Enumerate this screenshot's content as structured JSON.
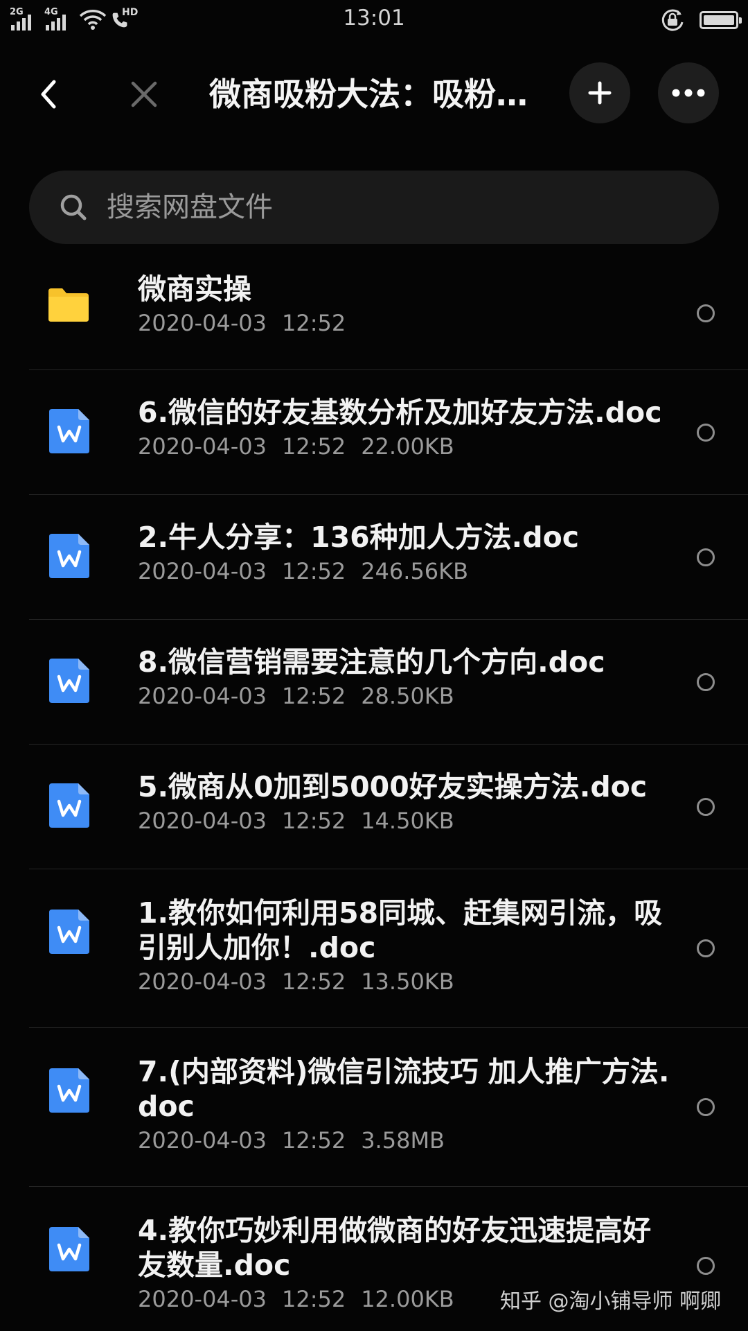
{
  "status_bar": {
    "time": "13:01",
    "signal_1_label": "2G",
    "signal_2_label": "4G",
    "call_label": "HD",
    "icons": [
      "signal-icon",
      "wifi-icon",
      "call-icon",
      "rotation-lock-icon",
      "battery-icon"
    ]
  },
  "header": {
    "title": "微商吸粉大法：吸粉…",
    "back_icon": "back-arrow-icon",
    "close_icon": "close-icon",
    "add_icon": "plus-icon",
    "more_icon": "more-icon"
  },
  "search": {
    "placeholder": "搜索网盘文件",
    "value": ""
  },
  "files": [
    {
      "type": "folder",
      "name": "微商实操",
      "date": "2020-04-03",
      "time": "12:52",
      "size": ""
    },
    {
      "type": "doc",
      "name": "6.微信的好友基数分析及加好友方法.doc",
      "date": "2020-04-03",
      "time": "12:52",
      "size": "22.00KB"
    },
    {
      "type": "doc",
      "name": "2.牛人分享：136种加人方法.doc",
      "date": "2020-04-03",
      "time": "12:52",
      "size": "246.56KB"
    },
    {
      "type": "doc",
      "name": "8.微信营销需要注意的几个方向.doc",
      "date": "2020-04-03",
      "time": "12:52",
      "size": "28.50KB"
    },
    {
      "type": "doc",
      "name": "5.微商从0加到5000好友实操方法.doc",
      "date": "2020-04-03",
      "time": "12:52",
      "size": "14.50KB"
    },
    {
      "type": "doc",
      "name": "1.教你如何利用58同城、赶集网引流，吸引别人加你！.doc",
      "date": "2020-04-03",
      "time": "12:52",
      "size": "13.50KB"
    },
    {
      "type": "doc",
      "name": "7.(内部资料)微信引流技巧 加人推广方法.doc",
      "date": "2020-04-03",
      "time": "12:52",
      "size": "3.58MB"
    },
    {
      "type": "doc",
      "name": "4.教你巧妙利用做微商的好友迅速提高好友数量.doc",
      "date": "2020-04-03",
      "time": "12:52",
      "size": "12.00KB"
    }
  ],
  "watermark": "知乎 @淘小铺导师 啊卿",
  "colors": {
    "background": "#050505",
    "folder": "#f7c22b",
    "word": "#3f8cf5",
    "text_primary": "#f2f2f2",
    "text_secondary": "#9b9b9b"
  }
}
